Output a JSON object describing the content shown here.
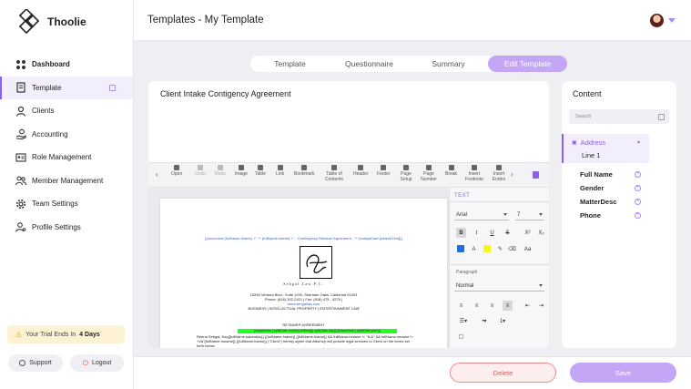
{
  "brand": {
    "name": "Thoolie",
    "accent": "#8b5cf6",
    "accent_soft": "#c4a6f7"
  },
  "sidebar": {
    "items": [
      {
        "label": "Dashboard",
        "icon": "grid-icon"
      },
      {
        "label": "Template",
        "icon": "document-icon"
      },
      {
        "label": "Clients",
        "icon": "person-icon"
      },
      {
        "label": "Accounting",
        "icon": "hand-coin-icon"
      },
      {
        "label": "Role Management",
        "icon": "id-card-icon"
      },
      {
        "label": "Member Management",
        "icon": "people-icon"
      },
      {
        "label": "Team Settings",
        "icon": "gear-icon"
      },
      {
        "label": "Profile Settings",
        "icon": "user-gear-icon"
      }
    ],
    "trial": {
      "prefix": "Your Trial Ends In",
      "days": "4 Days"
    },
    "support_label": "Support",
    "logout_label": "Logout"
  },
  "header": {
    "title": "Templates - My Template"
  },
  "tabs": [
    {
      "label": "Template"
    },
    {
      "label": "Questionnaire"
    },
    {
      "label": "Summary"
    },
    {
      "label": "Edit Template"
    }
  ],
  "editor": {
    "doc_title": "Client Intake Contigency Agreement",
    "toolbar": [
      {
        "label": "Open"
      },
      {
        "label": "Undo"
      },
      {
        "label": "Redo"
      },
      {
        "label": "Image"
      },
      {
        "label": "Table"
      },
      {
        "label": "Link"
      },
      {
        "label": "Bookmark"
      },
      {
        "label": "Table of Contents"
      },
      {
        "label": "Header"
      },
      {
        "label": "Footer"
      },
      {
        "label": "Page Setup"
      },
      {
        "label": "Page Number"
      },
      {
        "label": "Break"
      },
      {
        "label": "Insert Footnote"
      },
      {
        "label": "Insert Endno"
      }
    ],
    "document": {
      "merge_line": "{{document.{fullName.fname} +\" \"+ {fullName.lname} +\" - Contingency Retainer Agreement - \"+ {todaysDate.{dateAsText}}}",
      "firm_name": "Sehgal Law P.C.",
      "address": "15260 Ventura Blvd., Suite 1200, Sherman Oaks, California 91403",
      "phone": "Phone: (818) 302-2421 | Fax: (818) 475 - 5275 |",
      "website": "www.sehgallaw.com",
      "practice": "BUSINESS | INTELLECTUAL PROPERTY | ENTERTAINMENT LAW",
      "heading": "RETAINER AGREEMENT",
      "highlight": "{todaysDate.{.split(Date.month)}.toString().split(Date.day)} {todaysDate.{.split(Date.year)}}",
      "body": "Reena Sehgal, Esq{{fullName.salutation}} {{fullName.fname}} {{fullName.fname}} && fullName.mname != \"N A\" && fullName.mname != \"n/a\"{fullName.mname}} {{fullName.lname}} (\"Client\") hereby agree that Attorney will provide legal services to Client on the terms set forth below."
    },
    "format_panel": {
      "tab": "TEXT",
      "font": "Arial",
      "size": "7",
      "paragraph_label": "Paragraph",
      "style": "Normal",
      "buttons": {
        "bold": "B",
        "italic": "I",
        "underline": "U",
        "strike": "S",
        "superscript": "X²",
        "subscript": "X₂",
        "font_color": "A",
        "case": "Aa"
      },
      "colors": {
        "text": "#1e6fd9",
        "highlight": "#f7f71a"
      }
    }
  },
  "content_panel": {
    "title": "Content",
    "search_placeholder": "Search",
    "group": {
      "label": "Address",
      "child": "Line 1"
    },
    "fields": [
      "Full Name",
      "Gender",
      "MatterDesc",
      "Phone"
    ]
  },
  "footer": {
    "delete_label": "Delete",
    "save_label": "Save"
  }
}
